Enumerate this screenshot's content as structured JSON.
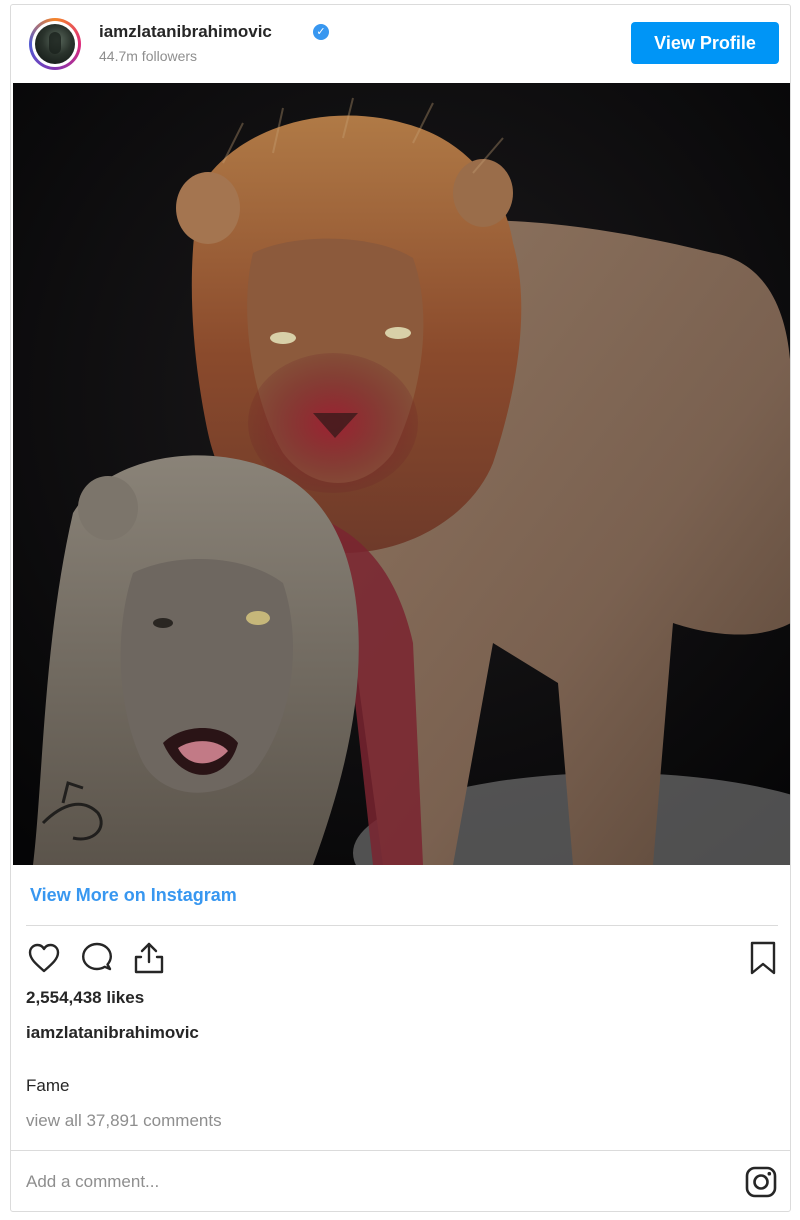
{
  "header": {
    "username": "iamzlatanibrahimovic",
    "verified_icon": "verified-badge-icon",
    "followers": "44.7m followers",
    "view_profile_label": "View Profile"
  },
  "post": {
    "image_alt": "Two lions at night, one with a bloodied mane and face",
    "view_more_label": "View More on Instagram",
    "actions": {
      "like_icon": "heart-icon",
      "comment_icon": "comment-icon",
      "share_icon": "share-icon",
      "save_icon": "bookmark-icon"
    },
    "likes": "2,554,438 likes",
    "caption_user": "iamzlatanibrahimovic",
    "caption_text": "Fame",
    "view_comments": "view all 37,891 comments"
  },
  "comment_box": {
    "placeholder": "Add a comment...",
    "logo_icon": "instagram-logo-icon"
  },
  "colors": {
    "accent": "#3897f0",
    "button": "#0095f6",
    "text": "#262626",
    "muted": "#8e8e8e",
    "border": "#dbdbdb"
  }
}
